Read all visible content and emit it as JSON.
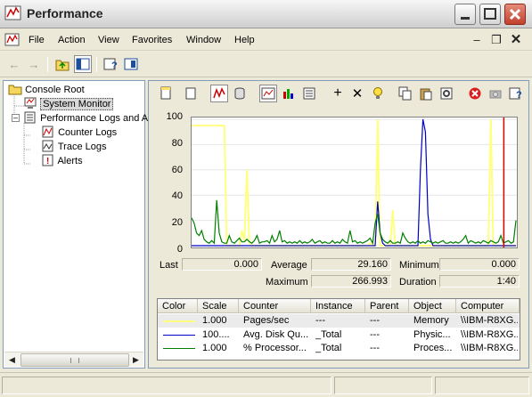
{
  "window": {
    "title": "Performance",
    "bg_color": "#ece9d8"
  },
  "menubar": {
    "items": [
      "File",
      "Action",
      "View",
      "Favorites",
      "Window",
      "Help"
    ]
  },
  "tree": {
    "root": "Console Root",
    "system_monitor": "System Monitor",
    "perf_logs": "Performance Logs and Alerts",
    "counter_logs": "Counter Logs",
    "trace_logs": "Trace Logs",
    "alerts": "Alerts"
  },
  "graph": {
    "y_ticks": [
      "100",
      "80",
      "60",
      "40",
      "20",
      "0"
    ],
    "ymax": 100,
    "series": [
      {
        "name": "Pages/sec",
        "color": "#ffff80",
        "values": [
          95,
          95,
          95,
          95,
          95,
          95,
          95,
          95,
          95,
          95,
          95,
          95,
          95,
          95,
          0,
          0,
          0,
          0,
          0,
          0,
          12,
          4,
          60,
          2,
          0,
          0,
          0,
          0,
          0,
          0,
          0,
          0,
          0,
          0,
          0,
          0,
          0,
          0,
          0,
          0,
          0,
          0,
          0,
          0,
          0,
          0,
          0,
          0,
          0,
          0,
          0,
          0,
          0,
          0,
          0,
          0,
          0,
          0,
          0,
          0,
          0,
          0,
          0,
          0,
          0,
          0,
          0,
          0,
          0,
          0,
          0,
          2,
          0,
          0,
          100,
          0,
          0,
          0,
          0,
          0,
          28,
          0,
          0,
          0,
          0,
          0,
          0,
          0,
          0,
          0,
          0,
          0,
          0,
          0,
          0,
          0,
          0,
          0,
          0,
          0,
          0,
          0,
          0,
          0,
          0,
          0,
          0,
          0,
          0,
          0,
          0,
          0,
          0,
          0,
          0,
          0,
          0,
          0,
          0,
          100,
          0,
          0,
          0,
          0,
          0,
          0,
          0,
          0,
          0,
          0
        ]
      },
      {
        "name": "Avg. Disk Queue Length",
        "color": "#0000c8",
        "values": [
          0,
          0,
          0,
          0,
          0,
          0,
          0,
          0,
          0,
          0,
          0,
          0,
          0,
          0,
          0,
          0,
          0,
          0,
          0,
          0,
          0,
          0,
          0,
          0,
          0,
          0,
          0,
          0,
          0,
          0,
          0,
          0,
          0,
          0,
          0,
          0,
          0,
          0,
          0,
          0,
          0,
          0,
          0,
          0,
          0,
          0,
          0,
          0,
          0,
          0,
          0,
          0,
          0,
          0,
          0,
          0,
          0,
          0,
          0,
          0,
          0,
          0,
          0,
          0,
          0,
          0,
          0,
          0,
          0,
          0,
          0,
          0,
          0,
          0,
          35,
          10,
          2,
          0,
          0,
          0,
          0,
          0,
          0,
          0,
          0,
          0,
          0,
          0,
          0,
          0,
          0,
          60,
          100,
          90,
          25,
          5,
          0,
          0,
          0,
          0,
          0,
          0,
          0,
          0,
          0,
          0,
          0,
          0,
          0,
          0,
          0,
          0,
          0,
          0,
          0,
          0,
          0,
          0,
          0,
          0,
          0,
          0,
          0,
          0,
          0,
          0,
          0,
          0,
          0,
          0
        ]
      },
      {
        "name": "% Processor Time",
        "color": "#008000",
        "values": [
          22,
          18,
          10,
          8,
          12,
          5,
          3,
          2,
          4,
          2,
          36,
          10,
          3,
          2,
          2,
          8,
          3,
          2,
          4,
          6,
          3,
          3,
          5,
          3,
          2,
          4,
          8,
          2,
          3,
          3,
          4,
          2,
          8,
          3,
          5,
          12,
          3,
          4,
          2,
          3,
          2,
          3,
          2,
          4,
          2,
          3,
          2,
          3,
          5,
          2,
          3,
          4,
          2,
          3,
          2,
          2,
          4,
          2,
          3,
          2,
          5,
          3,
          2,
          12,
          3,
          4,
          2,
          3,
          2,
          3,
          4,
          6,
          2,
          18,
          25,
          10,
          5,
          3,
          2,
          4,
          2,
          2,
          3,
          2,
          10,
          6,
          3,
          2,
          3,
          2,
          4,
          2,
          3,
          2,
          4,
          3,
          2,
          3,
          2,
          3,
          4,
          2,
          2,
          3,
          2,
          3,
          2,
          3,
          5,
          8,
          2,
          4,
          3,
          2,
          3,
          2,
          4,
          3,
          2,
          4,
          3,
          2,
          3,
          8,
          2,
          3,
          4,
          2,
          3,
          20
        ]
      }
    ],
    "cursor_color": "#e00000",
    "cursor_position_fraction": 0.96
  },
  "stats": {
    "last_label": "Last",
    "last": "0.000",
    "average_label": "Average",
    "average": "29.160",
    "minimum_label": "Minimum",
    "minimum": "0.000",
    "maximum_label": "Maximum",
    "maximum": "266.993",
    "duration_label": "Duration",
    "duration": "1:40"
  },
  "counters": {
    "headers": [
      "Color",
      "Scale",
      "Counter",
      "Instance",
      "Parent",
      "Object",
      "Computer"
    ],
    "rows": [
      {
        "color": "#ffff80",
        "scale": "1.000",
        "counter": "Pages/sec",
        "instance": "---",
        "parent": "---",
        "object": "Memory",
        "computer": "\\\\IBM-R8XG..."
      },
      {
        "color": "#0000c8",
        "scale": "100....",
        "counter": "Avg. Disk Qu...",
        "instance": "_Total",
        "parent": "---",
        "object": "Physic...",
        "computer": "\\\\IBM-R8XG..."
      },
      {
        "color": "#008000",
        "scale": "1.000",
        "counter": "% Processor...",
        "instance": "_Total",
        "parent": "---",
        "object": "Proces...",
        "computer": "\\\\IBM-R8XG..."
      }
    ]
  }
}
